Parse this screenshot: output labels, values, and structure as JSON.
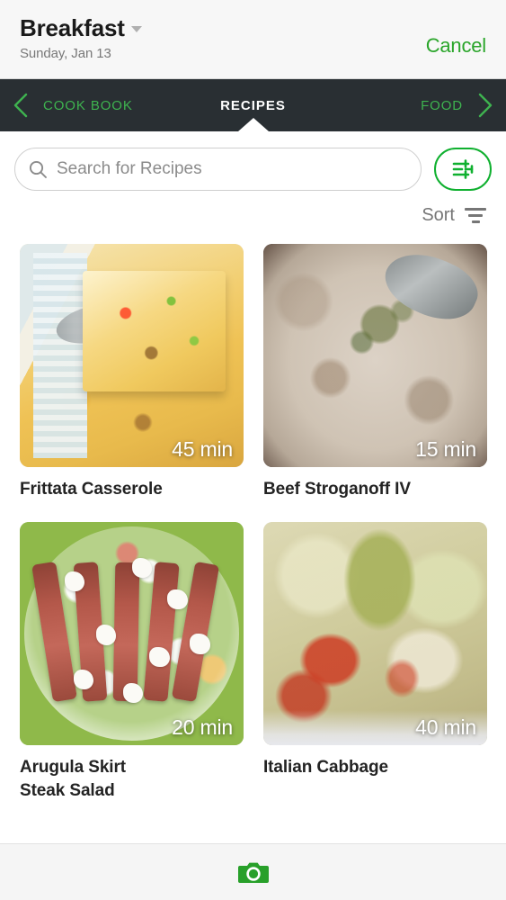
{
  "header": {
    "meal_title": "Breakfast",
    "meal_date": "Sunday, Jan 13",
    "cancel_label": "Cancel",
    "caret_icon": "caret-down-icon"
  },
  "navbar": {
    "prev_arrow_icon": "chevron-left-icon",
    "next_arrow_icon": "chevron-right-icon",
    "left_label": "COOK BOOK",
    "active_label": "RECIPES",
    "right_label": "FOOD",
    "active_color": "#ffffff",
    "link_color": "#3eb34f",
    "background": "#292f33"
  },
  "search": {
    "placeholder": "Search for Recipes",
    "value": "",
    "search_icon": "search-icon",
    "filter_icon": "sliders-icon",
    "filter_accent": "#0fb02f"
  },
  "sort": {
    "label": "Sort",
    "icon": "sort-lines-icon"
  },
  "recipes": [
    {
      "title": "Frittata Casserole",
      "time": "45 min",
      "image": "frittata-casserole-photo"
    },
    {
      "title": "Beef Stroganoff IV",
      "time": "15 min",
      "image": "beef-stroganoff-photo"
    },
    {
      "title": "Arugula Skirt\nSteak Salad",
      "time": "20 min",
      "image": "arugula-skirt-steak-salad-photo"
    },
    {
      "title": "Italian Cabbage",
      "time": "40 min",
      "image": "italian-cabbage-photo"
    }
  ],
  "bottom_bar": {
    "camera_icon": "camera-icon",
    "camera_color": "#28a02a"
  }
}
